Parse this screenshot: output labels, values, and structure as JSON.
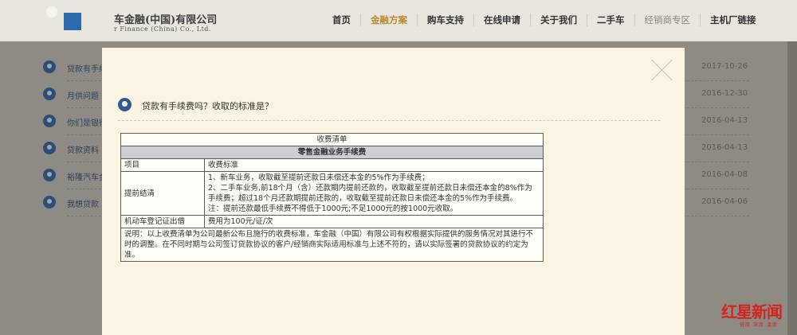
{
  "header": {
    "brand": "车金融(中国)有限公司",
    "brand_en": "r Finance (China) Co., Ltd.",
    "nav": [
      {
        "label": "首页"
      },
      {
        "label": "金融方案"
      },
      {
        "label": "购车支持"
      },
      {
        "label": "在线申请"
      },
      {
        "label": "关于我们"
      },
      {
        "label": "二手车"
      },
      {
        "label": "经销商专区"
      },
      {
        "label": "主机厂链接"
      }
    ]
  },
  "background_list": [
    {
      "title": "贷款有手续",
      "date": "2017-10-26"
    },
    {
      "title": "月供问题",
      "date": "2016-12-30"
    },
    {
      "title": "你们是银行",
      "date": "2016-04-13"
    },
    {
      "title": "贷款资料",
      "date": "2016-04-13"
    },
    {
      "title": "裕隆汽车金",
      "date": "2016-04-08"
    },
    {
      "title": "我想贷款",
      "date": "2016-04-06"
    }
  ],
  "modal": {
    "question": "贷款有手续费吗？收取的标准是？",
    "table": {
      "caption": "收费清单",
      "subcaption": "零售金融业务手续费",
      "col_item": "项目",
      "col_standard": "收费标准",
      "rows": [
        {
          "item": "提前结清",
          "lines": [
            "1、新车业务，收取截至提前还款日未偿还本金的5%作为手续费；",
            "2、二手车业务,前18个月（含）还款期内提前还款的，收取截至提前还款日未偿还本金的8%作为手续费；超过18个月还款期提前还款的，收取截至提前还款日未偿还本金的5%作为手续费。",
            "注：提前还款最低手续费不得低于1000元;不足1000元的按1000元收取。"
          ]
        },
        {
          "item": "机动车登记证出借",
          "lines": [
            "费用为100元/证/次"
          ]
        }
      ],
      "note": "说明：以上收费清单为公司最新公布且施行的收费标准，车金融（中国）有限公司有权根据实际提供的服务情况对其进行不时的调整。在不同时期与公司签订贷款协议的客户/经销商实际适用标准与上述不符的，请以实际签署的贷款协议的约定为准。"
    }
  },
  "watermark": {
    "text": "红星新闻",
    "sub": "锐度 深度 温度"
  }
}
